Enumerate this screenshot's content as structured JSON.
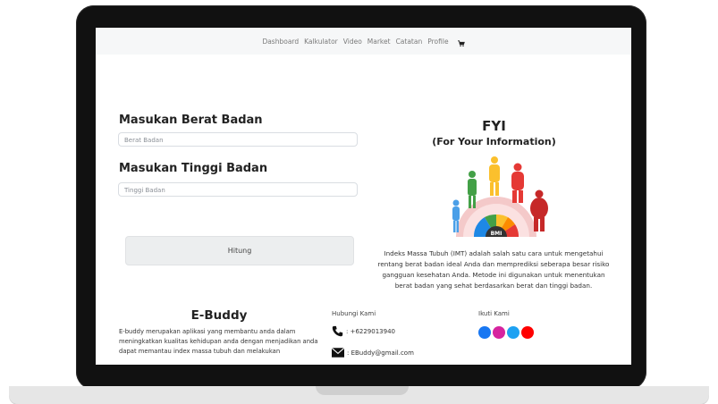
{
  "nav": {
    "items": [
      "Dashboard",
      "Kalkulator",
      "Video",
      "Market",
      "Catatan",
      "Profile"
    ]
  },
  "form": {
    "weight_heading": "Masukan Berat Badan",
    "weight_placeholder": "Berat Badan",
    "height_heading": "Masukan Tinggi Badan",
    "height_placeholder": "Tinggi Badan",
    "submit_label": "Hitung"
  },
  "fyi": {
    "title": "FYI",
    "subtitle": "(For Your Information)",
    "bmi_label": "BMI",
    "description": "Indeks Massa Tubuh (IMT) adalah salah satu cara untuk mengetahui rentang berat badan ideal Anda dan memprediksi seberapa besar risiko gangguan kesehatan Anda. Metode ini digunakan untuk menentukan berat badan yang sehat berdasarkan berat dan tinggi badan."
  },
  "footer": {
    "brand_title": "E-Buddy",
    "brand_desc": "E-buddy merupakan aplikasi yang membantu anda dalam meningkatkan kualitas kehidupan anda dengan menjadikan anda dapat memantau index massa tubuh dan melakukan",
    "contact_title": "Hubungi Kami",
    "phone": ": +6229013940",
    "email": ": EBuddy@gmail.com",
    "social_title": "Ikuti Kami",
    "social_icons": [
      "facebook-icon",
      "instagram-icon",
      "twitter-icon",
      "youtube-icon"
    ]
  },
  "colors": {
    "facebook": "#1877f2",
    "instagram": "#d6249f",
    "twitter": "#1da1f2",
    "youtube": "#ff0000"
  }
}
